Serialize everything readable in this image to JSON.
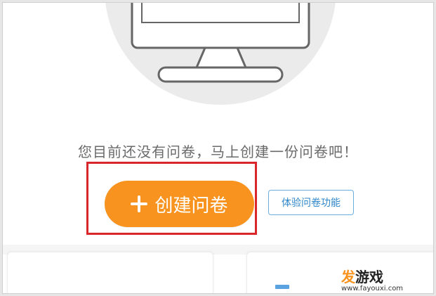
{
  "empty_state": {
    "message": "您目前还没有问卷，马上创建一份问卷吧！"
  },
  "actions": {
    "create_label": "创建问卷",
    "create_icon": "plus-icon",
    "trial_label": "体验问卷功能"
  },
  "watermark": {
    "brand": "发",
    "title": "游戏",
    "url": "www.fayouxi.com"
  },
  "colors": {
    "accent": "#f7931e",
    "highlight_border": "#d9262b",
    "link_blue": "#2f86c9"
  }
}
